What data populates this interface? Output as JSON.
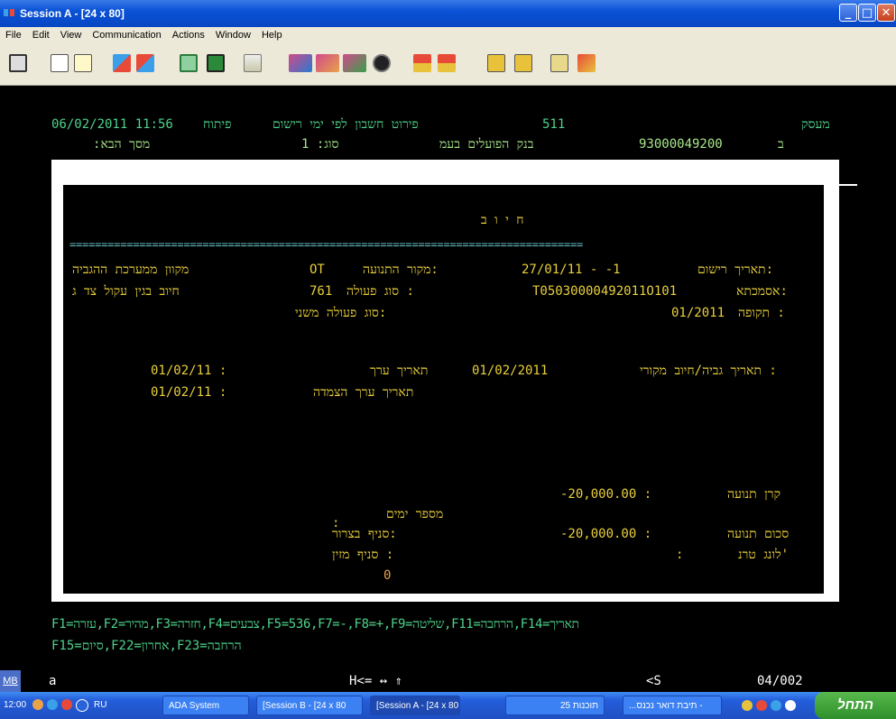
{
  "window": {
    "title": "Session A - [24 x 80]",
    "controls": {
      "minimize": "_",
      "maximize": "□",
      "close": "✕"
    }
  },
  "menu": [
    "File",
    "Edit",
    "View",
    "Communication",
    "Actions",
    "Window",
    "Help"
  ],
  "toolbar_icons": [
    "print-screen-icon",
    "copy-icon",
    "paste-icon",
    "send-icon",
    "receive-icon",
    "display-setup-icon",
    "color-icon",
    "edit-icon",
    "macro-record-icon",
    "macro-play-icon",
    "macro-stop-icon",
    "record-icon",
    "connect-icon",
    "disconnect-icon",
    "transfer-send-icon",
    "transfer-receive-icon",
    "clipboard-icon",
    "pen-icon"
  ],
  "terminal": {
    "header": {
      "date_time": "06/02/2011 11:56",
      "opened": "פיתוח",
      "screen_title": "פירוט חשבון לפי ימי רישום",
      "code": "511",
      "entity": "מעסק",
      "next_screen": ":מסך הבא",
      "type": "סוג: 1",
      "bank": "בנק הפועלים בעמ",
      "account": "93000049200",
      "branch": "ב"
    },
    "panel": {
      "title": "ח י ו ב",
      "separator": "=================================================================================",
      "reg_date_label": "תאריך רישום:",
      "reg_date_value": "27/01/11 - -1",
      "source_label": "מקור התנועה:",
      "source_value": "OT",
      "source_desc": "מקוון ממערכת ההגביה",
      "asmachta_label": "אסמכתא:",
      "asmachta_value": "T05030000492011O101",
      "action_type_label": "סוג פעולה :",
      "action_type_value": "761",
      "action_type_desc": "חיוב בגין עקול צד ג",
      "period_label": "תקופה :",
      "period_value": "01/2011",
      "secondary_action_label": "סוג פעולה משני:",
      "collection_date_label": "תאריך גביה/חיוב מקורי :",
      "collection_date_value": "01/02/2011",
      "value_date_label": "תאריך ערך",
      "value_date_value": "01/02/11 :",
      "linked_date_label": "תאריך ערך הצמדה",
      "linked_date_value": "01/02/11 :",
      "principal_label": "קרן תנועה",
      "principal_value": "-20,000.00 :",
      "days_label": "מספר ימים",
      "days_value": ":",
      "amount_label": "סכום תנועה",
      "amount_value": "-20,000.00 :",
      "clearing_branch_label": "סניף בצרור:",
      "long_term_label": "לונג טרנ'",
      "long_term_value": ":",
      "feeding_branch_label": "סניף מזין :",
      "counter_value": "0"
    },
    "function_keys_line1": "F1=עזרה,F2=מהיר,F3=חזרה,F4=צבעים,F5=536,F7=-,F8=+,F9=שליטה,F11=הרחבה,F14=תאריך",
    "function_keys_line2": "F15=סיום,F22=אחרון,F23=הרחבה"
  },
  "statusbar": {
    "mb": "MB",
    "session": "a",
    "keys": "H<= ↔ ⇑",
    "state": "<S",
    "position": "04/002"
  },
  "taskbar": {
    "clock": "12:00",
    "lang": "RU",
    "items": [
      {
        "label": "ADA System"
      },
      {
        "label": "[Session B - [24 x 80"
      },
      {
        "label": "[Session A - [24 x 80"
      },
      {
        "label": "25 תוכנות"
      },
      {
        "label": "...תיבת דואר נכנס -"
      }
    ],
    "start": "התחל"
  }
}
